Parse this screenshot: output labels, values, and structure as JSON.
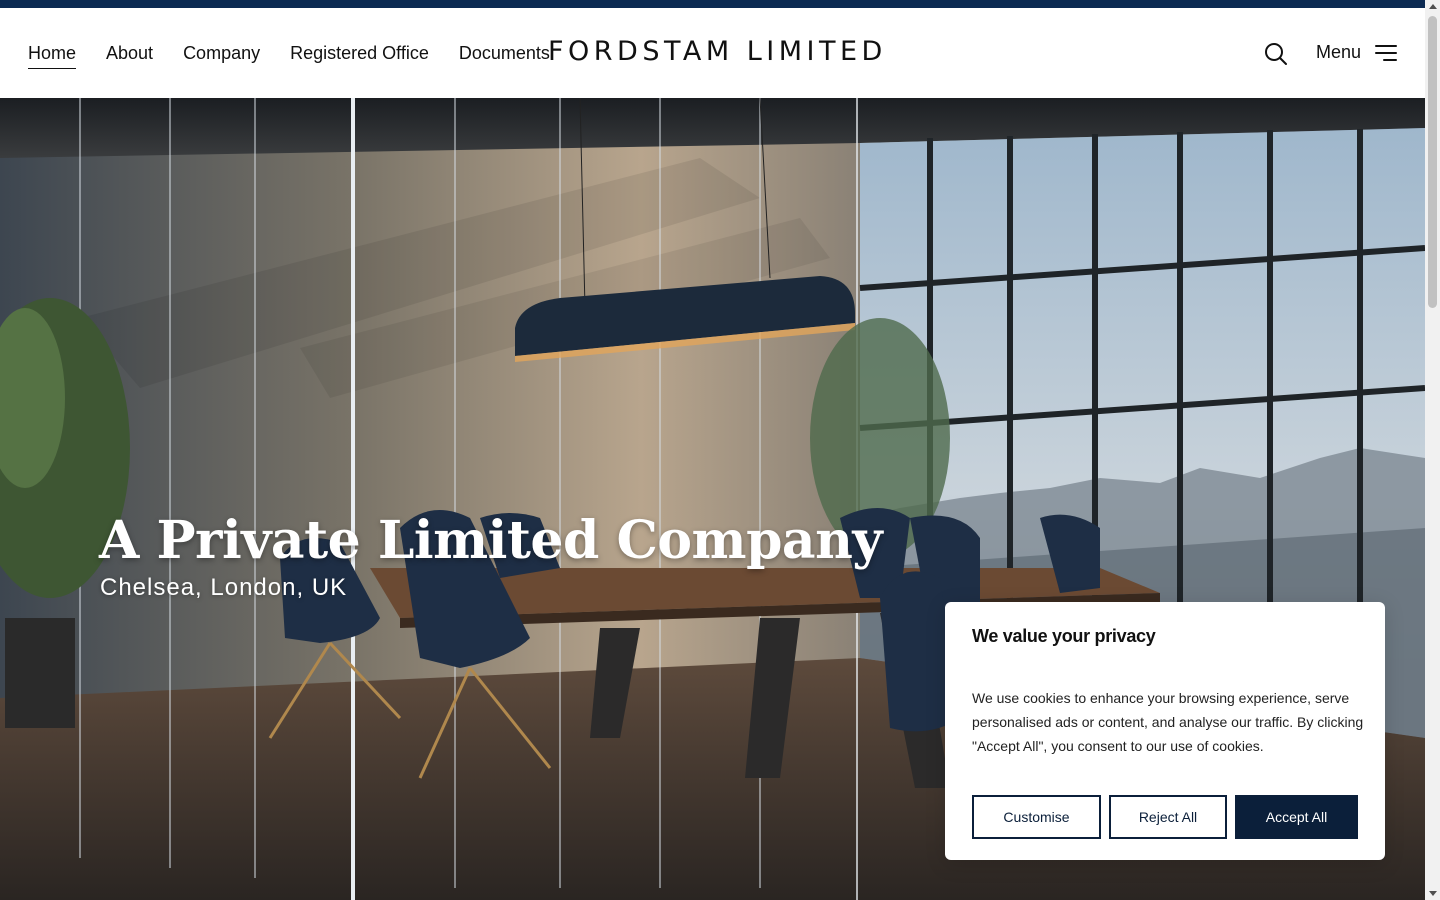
{
  "colors": {
    "top_strip": "#0b2a52",
    "accent_button": "#0b1f3a"
  },
  "nav": {
    "items": [
      {
        "label": "Home",
        "active": true
      },
      {
        "label": "About"
      },
      {
        "label": "Company"
      },
      {
        "label": "Registered Office"
      },
      {
        "label": "Documents"
      }
    ]
  },
  "brand": {
    "name": "FORDSTAM LIMITED"
  },
  "header": {
    "search_icon": "search-icon",
    "menu_label": "Menu",
    "menu_icon": "hamburger-icon"
  },
  "hero": {
    "title": "A Private Limited Company",
    "subtitle": "Chelsea, London, UK"
  },
  "cookie": {
    "title": "We value your privacy",
    "body": "We use cookies to enhance your browsing experience, serve personalised ads or content, and analyse our traffic. By clicking \"Accept All\", you consent to our use of cookies.",
    "customise_label": "Customise",
    "reject_label": "Reject All",
    "accept_label": "Accept All"
  }
}
